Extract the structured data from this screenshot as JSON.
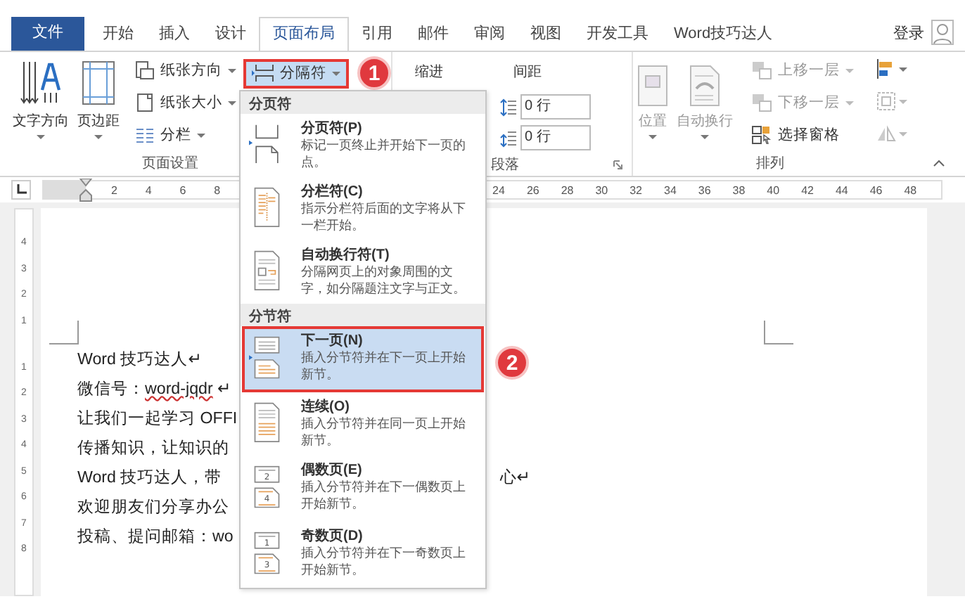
{
  "title_bar": {
    "sign_in": "登录"
  },
  "tabs": [
    {
      "label": "文件",
      "kind": "file",
      "selected": false
    },
    {
      "label": "开始",
      "kind": "tab",
      "selected": false
    },
    {
      "label": "插入",
      "kind": "tab",
      "selected": false
    },
    {
      "label": "设计",
      "kind": "tab",
      "selected": false
    },
    {
      "label": "页面布局",
      "kind": "tab",
      "selected": true
    },
    {
      "label": "引用",
      "kind": "tab",
      "selected": false
    },
    {
      "label": "邮件",
      "kind": "tab",
      "selected": false
    },
    {
      "label": "审阅",
      "kind": "tab",
      "selected": false
    },
    {
      "label": "视图",
      "kind": "tab",
      "selected": false
    },
    {
      "label": "开发工具",
      "kind": "tab",
      "selected": false
    },
    {
      "label": "Word技巧达人",
      "kind": "tab",
      "selected": false
    }
  ],
  "ribbon": {
    "page_setup": {
      "label": "页面设置",
      "large_buttons": [
        {
          "label": "文字方向"
        },
        {
          "label": "页边距"
        }
      ],
      "small_buttons": [
        {
          "label": "纸张方向"
        },
        {
          "label": "纸张大小"
        },
        {
          "label": "分栏"
        }
      ],
      "breaks_button": {
        "label": "分隔符",
        "selected": true,
        "highlighted": true,
        "callout": "1"
      }
    },
    "paragraph": {
      "label": "段落",
      "indent_label": "缩进",
      "spacing_label": "间距",
      "spacing_fields": [
        {
          "kind": "before",
          "value": "0 行"
        },
        {
          "kind": "after",
          "value": "0 行"
        }
      ]
    },
    "arrange": {
      "label": "排列",
      "large_buttons": [
        {
          "label": "位置",
          "disabled": true
        },
        {
          "label": "自动换行",
          "disabled": true
        }
      ],
      "small_buttons": [
        {
          "label": "上移一层",
          "disabled": true
        },
        {
          "label": "下移一层",
          "disabled": true
        },
        {
          "label": "选择窗格",
          "disabled": false
        }
      ],
      "icon_buttons": [
        {
          "disabled": false
        },
        {
          "disabled": true
        },
        {
          "disabled": true
        }
      ]
    }
  },
  "ruler": {
    "left_numbers": [
      "2",
      "4",
      "6",
      "8"
    ],
    "right_numbers": [
      "24",
      "26",
      "28",
      "30",
      "32",
      "34",
      "36",
      "38",
      "40",
      "42",
      "44",
      "46",
      "48"
    ]
  },
  "vertical_ruler": {
    "top_numbers": [
      "4",
      "3",
      "2",
      "1"
    ],
    "bottom_numbers": [
      "1",
      "2",
      "3",
      "4",
      "5",
      "6",
      "7",
      "8"
    ]
  },
  "document": {
    "lines": [
      {
        "segments": [
          {
            "text": "Word 技巧达人↵",
            "misspelled": false
          }
        ]
      },
      {
        "segments": [
          {
            "text": "微信号：",
            "misspelled": false
          },
          {
            "text": "word-jqdr",
            "misspelled": true
          },
          {
            "text": " ↵",
            "misspelled": false
          }
        ]
      },
      {
        "segments": [
          {
            "text": "让我们一起学习 OFFI",
            "misspelled": false
          }
        ]
      },
      {
        "segments": [
          {
            "text": "传播知识，让知识的",
            "misspelled": false
          }
        ]
      },
      {
        "segments": [
          {
            "text": "Word 技巧达人，带",
            "misspelled": false
          }
        ],
        "tail": "心↵"
      },
      {
        "segments": [
          {
            "text": "欢迎朋友们分享办公",
            "misspelled": false
          }
        ]
      },
      {
        "segments": [
          {
            "text": "投稿、提问邮箱：wo",
            "misspelled": false
          }
        ]
      }
    ]
  },
  "breaks_menu": {
    "sections": [
      {
        "header": "分页符",
        "items": [
          {
            "kind": "page",
            "title": "分页符(P)",
            "description": "标记一页终止并开始下一页的点。",
            "selected": false
          },
          {
            "kind": "column",
            "title": "分栏符(C)",
            "description": "指示分栏符后面的文字将从下一栏开始。",
            "selected": false
          },
          {
            "kind": "wrap",
            "title": "自动换行符(T)",
            "description": "分隔网页上的对象周围的文字，如分隔题注文字与正文。",
            "selected": false
          }
        ]
      },
      {
        "header": "分节符",
        "items": [
          {
            "kind": "next",
            "title": "下一页(N)",
            "description": "插入分节符并在下一页上开始新节。",
            "selected": true,
            "callout": "2"
          },
          {
            "kind": "continuous",
            "title": "连续(O)",
            "description": "插入分节符并在同一页上开始新节。",
            "selected": false
          },
          {
            "kind": "numbered",
            "title": "偶数页(E)",
            "description": "插入分节符并在下一偶数页上开始新节。",
            "selected": false,
            "icon_labels": [
              "2",
              "4"
            ]
          },
          {
            "kind": "numbered",
            "title": "奇数页(D)",
            "description": "插入分节符并在下一奇数页上开始新节。",
            "selected": false,
            "icon_labels": [
              "1",
              "3"
            ]
          }
        ]
      }
    ]
  }
}
